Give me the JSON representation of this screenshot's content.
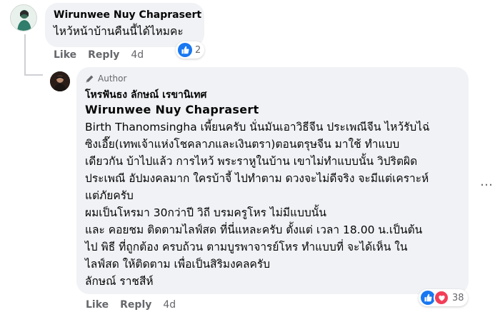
{
  "comment": {
    "author": "Wirunwee Nuy Chaprasert",
    "text": "ไหว้หน้าบ้านคืนนี้ได้ไหมคะ",
    "actions": {
      "like": "Like",
      "reply": "Reply",
      "time": "4d"
    },
    "reaction_count": "2",
    "avatar_icon": "profile-photo-icon"
  },
  "reply": {
    "badge": "Author",
    "author": "โหรฟันธง ลักษณ์ เรขานิเทศ",
    "mention": "Wirunwee Nuy Chaprasert",
    "lines": [
      "Birth Thanomsingha เพี้ยนครับ นั่นมันเอาวิธีจีน ประเพณีจีน ไหว้รับไฉ่",
      "ซิงเอี๊ย(เทพเจ้าแห่งโชคลาภและเงินตรา)ตอนตรุษจีน มาใช้ ทำแบบ",
      "เดียวกัน บ้าไปแล้ว การไหว้ พระราหูในบ้าน เขาไม่ทำแบบนั้น วิปริตผิด",
      "ประเพณี อัปมงคลมาก ใครบ้าจี้ ไปทำตาม ดวงจะไม่ดีจริง จะมีแต่เคราะห์",
      "แต่ภัยครับ",
      "ผมเป็นโหรมา 30กว่าปี วิถี บรมครูโหร ไม่มีแบบนั้น",
      "และ คอยชม ติดตามไลฟ์สด ที่นี่แหละครับ ตั้งแต่ เวลา 18.00 น.เป็นต้น",
      "ไป พิธี ที่ถูกต้อง ครบถ้วน ตามบูรพาจารย์โหร ทำแบบที่ จะได้เห็น ใน",
      "ไลฟ์สด ให้ติดตาม เพื่อเป็นสิริมงคลครับ",
      "ลักษณ์ ราชสีห์"
    ],
    "actions": {
      "like": "Like",
      "reply": "Reply",
      "time": "4d"
    },
    "reaction_count": "38",
    "more": "…"
  },
  "colors": {
    "like_blue": "#1877f2",
    "love_red": "#f33e58",
    "bubble": "#f0f2f5",
    "meta": "#65676b"
  }
}
